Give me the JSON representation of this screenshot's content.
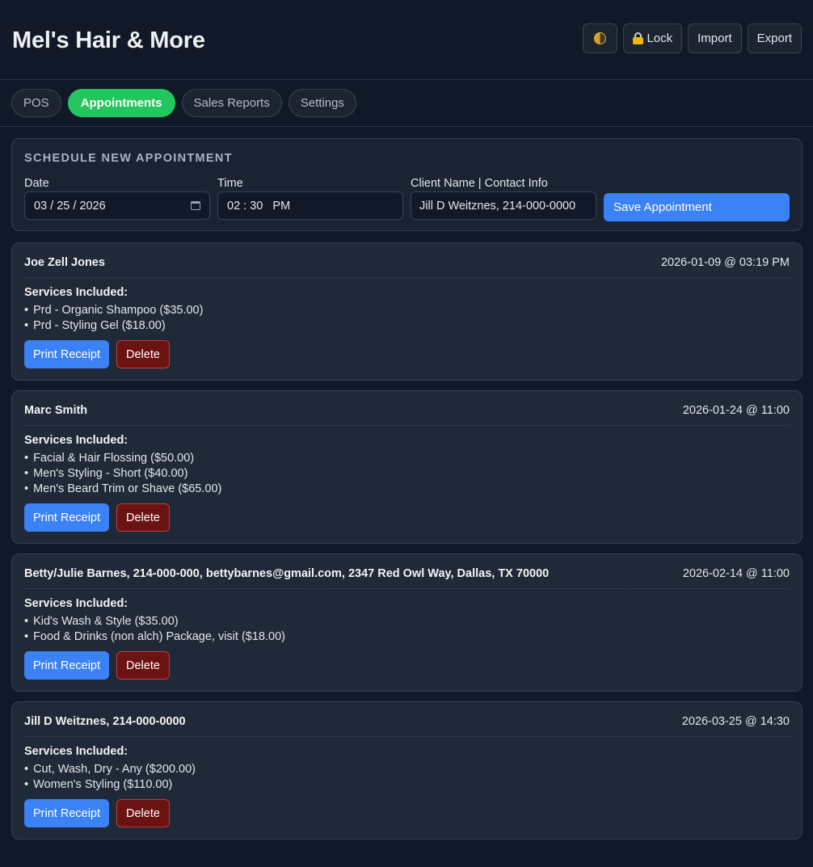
{
  "header": {
    "title": "Mel's Hair & More",
    "theme_icon": "half-moon-icon",
    "lock_label": "Lock",
    "import_label": "Import",
    "export_label": "Export"
  },
  "tabs": [
    {
      "label": "POS",
      "active": false
    },
    {
      "label": "Appointments",
      "active": true
    },
    {
      "label": "Sales Reports",
      "active": false
    },
    {
      "label": "Settings",
      "active": false
    }
  ],
  "schedule": {
    "title": "SCHEDULE NEW APPOINTMENT",
    "date_label": "Date",
    "date_value": "03 / 25 / 2026",
    "time_label": "Time",
    "time_value": "02 : 30   PM",
    "client_label": "Client Name | Contact Info",
    "client_value": "Jill D Weitznes, 214-000-0000",
    "save_label": "Save Appointment"
  },
  "appointments": [
    {
      "client": "Joe Zell Jones",
      "when": "2026-01-09 @ 03:19 PM",
      "services_title": "Services Included:",
      "services": [
        "Prd - Organic Shampoo ($35.00)",
        "Prd - Styling Gel ($18.00)"
      ],
      "print_label": "Print Receipt",
      "delete_label": "Delete"
    },
    {
      "client": "Marc Smith",
      "when": "2026-01-24 @ 11:00",
      "services_title": "Services Included:",
      "services": [
        "Facial & Hair Flossing ($50.00)",
        "Men's Styling - Short ($40.00)",
        "Men's Beard Trim or Shave ($65.00)"
      ],
      "print_label": "Print Receipt",
      "delete_label": "Delete"
    },
    {
      "client": "Betty/Julie Barnes, 214-000-000, bettybarnes@gmail.com, 2347 Red Owl Way, Dallas, TX 70000",
      "when": "2026-02-14 @ 11:00",
      "services_title": "Services Included:",
      "services": [
        "Kid's Wash & Style ($35.00)",
        "Food & Drinks (non alch) Package, visit ($18.00)"
      ],
      "print_label": "Print Receipt",
      "delete_label": "Delete"
    },
    {
      "client": "Jill D Weitznes, 214-000-0000",
      "when": "2026-03-25 @ 14:30",
      "services_title": "Services Included:",
      "services": [
        "Cut, Wash, Dry - Any ($200.00)",
        "Women's Styling ($110.00)"
      ],
      "print_label": "Print Receipt",
      "delete_label": "Delete"
    }
  ],
  "colors": {
    "background": "#111827",
    "card": "#1f2937",
    "active_tab": "#22c55e",
    "primary_button": "#3b82f6",
    "danger_button": "#6b1212"
  }
}
